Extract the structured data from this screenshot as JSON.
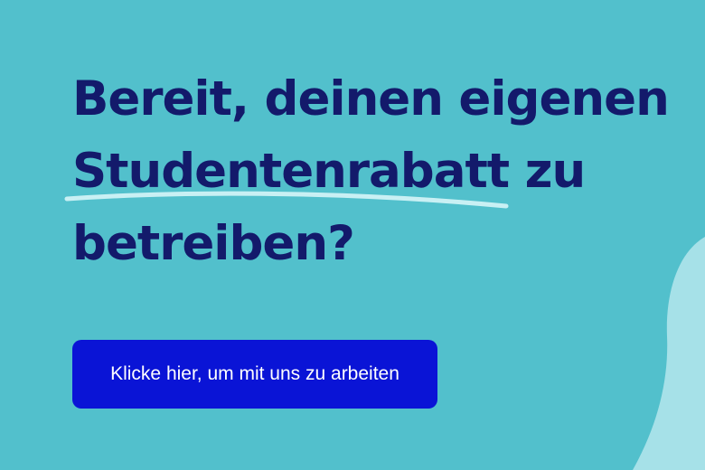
{
  "hero": {
    "headline_lines": [
      "Bereit, deinen eigenen",
      "Studentenrabatt zu",
      "betreiben?"
    ],
    "cta_label": "Klicke hier, um mit uns zu arbeiten"
  },
  "colors": {
    "background": "#52c0cc",
    "headline": "#131a6b",
    "button": "#0a14d6",
    "button_text": "#ffffff",
    "accent_blob": "#a6e1e8",
    "underline": "#c9f0f4"
  }
}
